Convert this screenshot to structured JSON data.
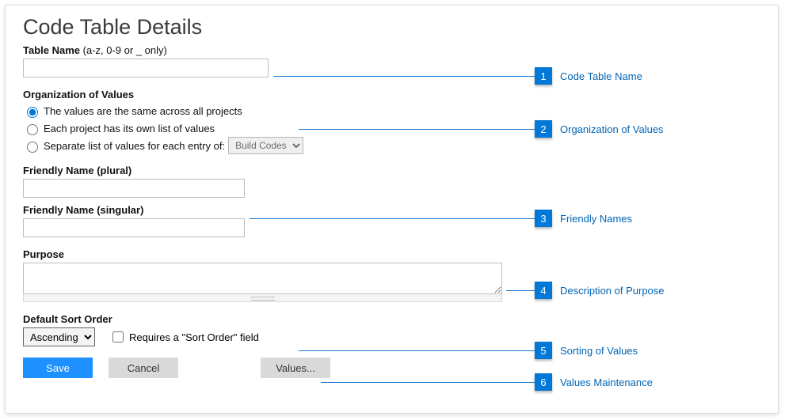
{
  "title": "Code Table Details",
  "tableName": {
    "label": "Table Name",
    "hint": "(a-z, 0-9 or _ only)",
    "value": ""
  },
  "organization": {
    "label": "Organization of Values",
    "opt1": "The values are the same across all projects",
    "opt2": "Each project has its own list of values",
    "opt3": "Separate list of values for each entry of:",
    "selectValue": "Build Codes"
  },
  "friendlyPlural": {
    "label": "Friendly Name (plural)",
    "value": ""
  },
  "friendlySingular": {
    "label": "Friendly Name (singular)",
    "value": ""
  },
  "purpose": {
    "label": "Purpose",
    "value": ""
  },
  "sort": {
    "label": "Default Sort Order",
    "value": "Ascending",
    "checkboxLabel": "Requires a \"Sort Order\" field"
  },
  "buttons": {
    "save": "Save",
    "cancel": "Cancel",
    "values": "Values..."
  },
  "callouts": {
    "c1": "Code Table Name",
    "c2": "Organization of Values",
    "c3": "Friendly Names",
    "c4": "Description of Purpose",
    "c5": "Sorting of Values",
    "c6": "Values Maintenance"
  }
}
